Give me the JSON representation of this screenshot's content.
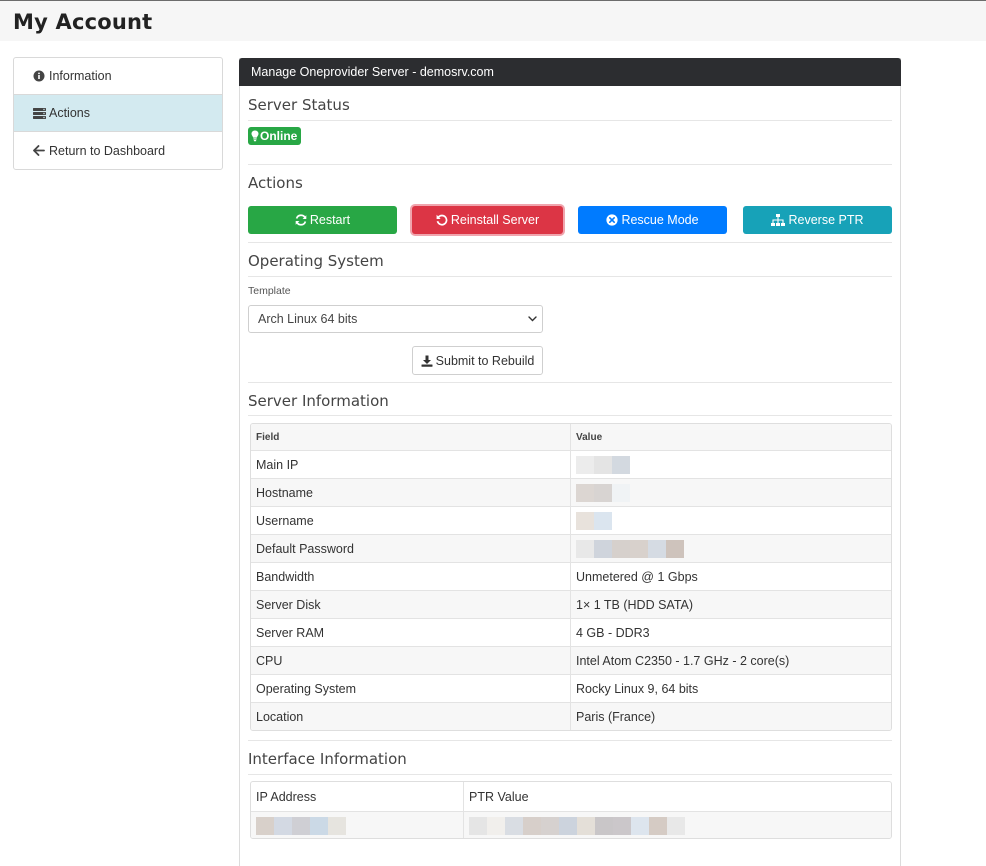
{
  "page": {
    "title": "My Account"
  },
  "sidebar": {
    "items": [
      {
        "label": "Information",
        "icon": "info-circle-icon"
      },
      {
        "label": "Actions",
        "icon": "server-stack-icon",
        "active": true
      },
      {
        "label": "Return to Dashboard",
        "icon": "arrow-left-icon"
      }
    ]
  },
  "panel": {
    "title": "Manage Oneprovider Server - demosrv.com",
    "status": {
      "heading": "Server Status",
      "badge": "Online",
      "badge_color": "#28a745"
    },
    "actions": {
      "heading": "Actions",
      "restart": "Restart",
      "reinstall": "Reinstall Server",
      "rescue": "Rescue Mode",
      "reverse_ptr": "Reverse PTR"
    },
    "os": {
      "heading": "Operating System",
      "template_label": "Template",
      "selected_template": "Arch Linux 64 bits",
      "submit": "Submit to Rebuild"
    },
    "server_info": {
      "heading": "Server Information",
      "columns": [
        "Field",
        "Value"
      ],
      "rows": [
        {
          "field": "Main IP",
          "value": ""
        },
        {
          "field": "Hostname",
          "value": ""
        },
        {
          "field": "Username",
          "value": ""
        },
        {
          "field": "Default Password",
          "value": ""
        },
        {
          "field": "Bandwidth",
          "value": "Unmetered @ 1 Gbps"
        },
        {
          "field": "Server Disk",
          "value": "1× 1 TB (HDD SATA)"
        },
        {
          "field": "Server RAM",
          "value": "4 GB - DDR3"
        },
        {
          "field": "CPU",
          "value": "Intel Atom C2350 - 1.7 GHz - 2 core(s)"
        },
        {
          "field": "Operating System",
          "value": "Rocky Linux 9, 64 bits"
        },
        {
          "field": "Location",
          "value": "Paris (France)"
        }
      ]
    },
    "interface_info": {
      "heading": "Interface Information",
      "columns": [
        "IP Address",
        "PTR Value"
      ]
    }
  },
  "colors": {
    "green": "#28a745",
    "red": "#dc3545",
    "blue": "#007bff",
    "teal": "#17a2b8",
    "panel_header": "#2c2d30",
    "active_sidebar": "#d3eaf0"
  }
}
